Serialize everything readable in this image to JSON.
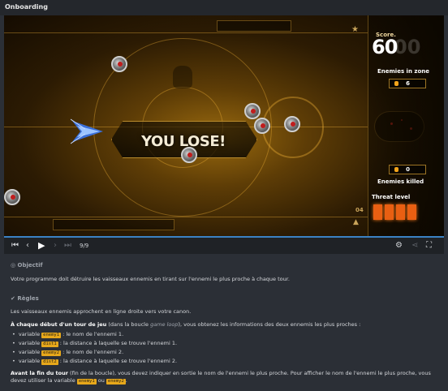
{
  "window": {
    "title": "Onboarding"
  },
  "game": {
    "overlay_text": "YOU LOSE!",
    "score_label": "Score.",
    "score_value": "60",
    "score_ghost": "00",
    "enemies_in_zone_label": "Enemies in zone",
    "enemies_in_zone_value": "6",
    "enemies_killed_label": "Enemies killed",
    "enemies_killed_value": "0",
    "threat_label": "Threat level",
    "threat_level": 4,
    "level_number": "04",
    "accent_color": "#f3a41b",
    "threat_color": "#e95f12"
  },
  "controls": {
    "first_icon": "skip-to-start-icon",
    "prev_icon": "step-back-icon",
    "play_icon": "play-icon",
    "next_icon": "step-forward-icon",
    "last_icon": "skip-to-end-icon",
    "frame_counter": "9/9",
    "settings_icon": "gear-icon",
    "share_icon": "share-icon",
    "fullscreen_icon": "fullscreen-icon"
  },
  "content": {
    "objective_title": "Objectif",
    "objective_text": "Votre programme doit détruire les vaisseaux ennemis en tirant sur l'ennemi le plus proche à chaque tour.",
    "rules_title": "Règles",
    "rules_intro": "Les vaisseaux ennemis approchent en ligne droite vers votre canon.",
    "turn_start_bold": "À chaque début d'un tour de jeu",
    "turn_start_rest_1": " (dans la boucle ",
    "turn_start_italic": "game loop",
    "turn_start_rest_2": "), vous obtenez les informations des deux ennemis les plus proches :",
    "bullets": [
      {
        "prefix": "variable ",
        "var": "enemy1",
        "suffix": " : le nom de l'ennemi 1."
      },
      {
        "prefix": "variable ",
        "var": "dist1",
        "suffix": " : la distance à laquelle se trouve l'ennemi 1."
      },
      {
        "prefix": "variable ",
        "var": "enemy2",
        "suffix": " : le nom de l'ennemi 2."
      },
      {
        "prefix": "variable ",
        "var": "dist2",
        "suffix": " : la distance à laquelle se trouve l'ennemi 2."
      }
    ],
    "turn_end_bold": "Avant la fin du tour",
    "turn_end_rest": " (fin de la boucle), vous devez indiquer en sortie le nom de l'ennemi le plus proche. Pour afficher le nom de l'ennemi le plus proche, vous devez utiliser la variable ",
    "turn_end_var1": "enemy1",
    "turn_end_or": " ou ",
    "turn_end_var2": "enemy2",
    "turn_end_dot": "."
  }
}
